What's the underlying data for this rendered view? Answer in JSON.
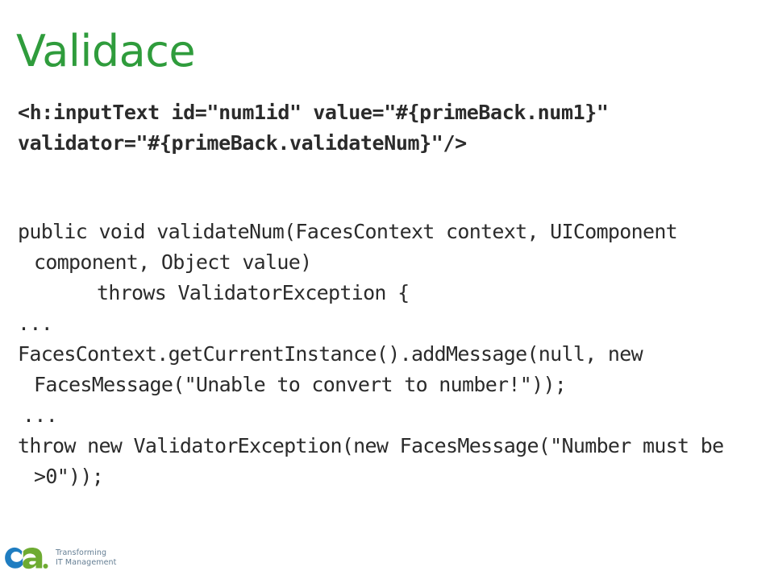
{
  "slide": {
    "title": "Validace",
    "title_color": "#2f9c3c",
    "background_color": "#ffffff",
    "text_color": "#2b2b2b"
  },
  "code": {
    "markup_snippet": {
      "language": "xhtml",
      "line1": "<h:inputText id=\"num1id\" value=\"#{primeBack.num1}\"",
      "line2": "validator=\"#{primeBack.validateNum}\"/>"
    },
    "java_snippet": {
      "language": "java",
      "line1": "public void validateNum(FacesContext context, UIComponent component, Object value)",
      "line2": "throws ValidatorException {",
      "line3": "...",
      "line4": "FacesContext.getCurrentInstance().addMessage(null, new FacesMessage(\"Unable to convert to number!\"));",
      "line5": "...",
      "line6": "throw new ValidatorException(new FacesMessage(\"Number must be >0\"));"
    }
  },
  "footer": {
    "logo_text": "ca",
    "logo_blue": "#1879bf",
    "logo_green": "#6aa92c",
    "tagline_line1": "Transforming",
    "tagline_line2": "IT Management",
    "tagline_color": "#5f7a90"
  }
}
